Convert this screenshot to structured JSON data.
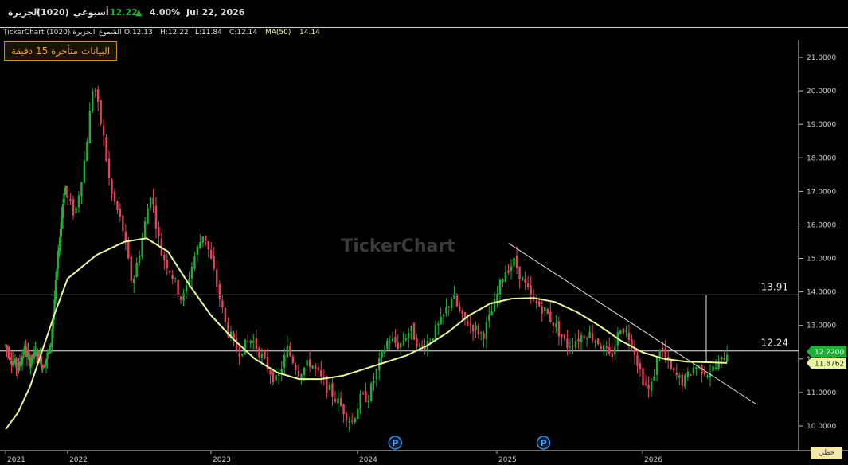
{
  "header": {
    "symbol_name": "الجزيرة",
    "symbol_code": "(1020)",
    "period": "أسبوعي",
    "price": "12.22",
    "change_pct": "4.00%",
    "date": "Jul 22, 2026"
  },
  "info": {
    "source": "TickerChart (1020) الجزيرة",
    "type": "الشموع",
    "open": "O:12.13",
    "high": "H:12.22",
    "low": "L:11.84",
    "close": "C:12.14",
    "ma_label": "MA(50)",
    "ma_value": "14.14"
  },
  "delay_notice": "البيانات متأخرة 15 دقيقة",
  "watermark": "TickerChart",
  "scale_button": "خطي",
  "colors": {
    "up": "#1fae3a",
    "down": "#e0455a",
    "ma": "#e6f7a0",
    "trend": "#dddddd",
    "background": "#000000",
    "price_tag": "#1fae3a",
    "ma_tag": "#e6f7a0"
  },
  "chart_data": {
    "type": "candlestick",
    "x_ticks": [
      "2021",
      "2022",
      "2023",
      "2024",
      "2025",
      "2026"
    ],
    "y_ticks": [
      "10.0000",
      "11.0000",
      "12.0000",
      "13.0000",
      "14.0000",
      "15.0000",
      "16.0000",
      "17.0000",
      "18.0000",
      "19.0000",
      "20.0000",
      "21.0000"
    ],
    "ylim": [
      9.6,
      21.4
    ],
    "xlim": [
      2021.0,
      2026.95
    ],
    "horizontal_lines": [
      {
        "label": "13.91",
        "value": 13.91
      },
      {
        "label": "12.24",
        "value": 12.24
      }
    ],
    "last_price_tag": "12.2200",
    "ma_tag": "11.8762",
    "trend_line": {
      "start": [
        2025.08,
        15.45
      ],
      "end": [
        2026.78,
        10.65
      ]
    },
    "event_markers": [
      "P",
      "P"
    ],
    "event_marker_x": [
      2024.27,
      2025.32
    ],
    "price_path": [
      [
        2021.0,
        12.4
      ],
      [
        2021.1,
        12.0
      ],
      [
        2021.2,
        11.7
      ],
      [
        2021.3,
        12.3
      ],
      [
        2021.4,
        11.9
      ],
      [
        2021.5,
        12.2
      ],
      [
        2021.6,
        11.8
      ],
      [
        2021.72,
        12.3
      ],
      [
        2021.8,
        14.0
      ],
      [
        2021.88,
        15.8
      ],
      [
        2021.95,
        17.2
      ],
      [
        2022.05,
        16.3
      ],
      [
        2022.12,
        18.0
      ],
      [
        2022.18,
        20.3
      ],
      [
        2022.25,
        18.6
      ],
      [
        2022.3,
        17.0
      ],
      [
        2022.38,
        16.0
      ],
      [
        2022.45,
        14.2
      ],
      [
        2022.52,
        15.6
      ],
      [
        2022.58,
        17.0
      ],
      [
        2022.65,
        15.2
      ],
      [
        2022.72,
        14.6
      ],
      [
        2022.8,
        13.7
      ],
      [
        2022.88,
        15.0
      ],
      [
        2022.95,
        15.8
      ],
      [
        2023.02,
        14.6
      ],
      [
        2023.1,
        13.0
      ],
      [
        2023.18,
        12.2
      ],
      [
        2023.28,
        12.6
      ],
      [
        2023.38,
        11.8
      ],
      [
        2023.45,
        11.3
      ],
      [
        2023.52,
        12.3
      ],
      [
        2023.6,
        11.6
      ],
      [
        2023.68,
        11.9
      ],
      [
        2023.75,
        11.4
      ],
      [
        2023.82,
        11.0
      ],
      [
        2023.9,
        10.5
      ],
      [
        2023.96,
        10.1
      ],
      [
        2024.02,
        10.8
      ],
      [
        2024.08,
        10.9
      ],
      [
        2024.15,
        11.8
      ],
      [
        2024.22,
        12.6
      ],
      [
        2024.3,
        12.4
      ],
      [
        2024.38,
        12.9
      ],
      [
        2024.45,
        12.3
      ],
      [
        2024.52,
        12.6
      ],
      [
        2024.6,
        13.1
      ],
      [
        2024.68,
        13.9
      ],
      [
        2024.75,
        13.2
      ],
      [
        2024.82,
        13.0
      ],
      [
        2024.9,
        12.7
      ],
      [
        2024.98,
        13.6
      ],
      [
        2025.05,
        14.6
      ],
      [
        2025.12,
        14.9
      ],
      [
        2025.18,
        14.3
      ],
      [
        2025.25,
        13.7
      ],
      [
        2025.32,
        13.5
      ],
      [
        2025.4,
        13.0
      ],
      [
        2025.48,
        12.4
      ],
      [
        2025.55,
        12.6
      ],
      [
        2025.62,
        12.8
      ],
      [
        2025.7,
        12.5
      ],
      [
        2025.78,
        12.0
      ],
      [
        2025.85,
        13.0
      ],
      [
        2025.92,
        12.6
      ],
      [
        2026.0,
        11.4
      ],
      [
        2026.05,
        11.0
      ],
      [
        2026.12,
        12.4
      ],
      [
        2026.2,
        11.6
      ],
      [
        2026.28,
        11.3
      ],
      [
        2026.36,
        11.8
      ],
      [
        2026.45,
        11.6
      ],
      [
        2026.52,
        11.8
      ],
      [
        2026.58,
        12.22
      ]
    ],
    "ma50_path": [
      [
        2021.0,
        9.9
      ],
      [
        2021.2,
        10.4
      ],
      [
        2021.4,
        11.2
      ],
      [
        2021.6,
        12.3
      ],
      [
        2021.8,
        13.4
      ],
      [
        2022.0,
        14.4
      ],
      [
        2022.2,
        15.1
      ],
      [
        2022.4,
        15.5
      ],
      [
        2022.55,
        15.6
      ],
      [
        2022.7,
        15.2
      ],
      [
        2022.85,
        14.2
      ],
      [
        2023.0,
        13.3
      ],
      [
        2023.15,
        12.6
      ],
      [
        2023.3,
        12.0
      ],
      [
        2023.45,
        11.6
      ],
      [
        2023.6,
        11.4
      ],
      [
        2023.75,
        11.4
      ],
      [
        2023.9,
        11.5
      ],
      [
        2024.05,
        11.7
      ],
      [
        2024.2,
        11.9
      ],
      [
        2024.35,
        12.1
      ],
      [
        2024.5,
        12.4
      ],
      [
        2024.65,
        12.8
      ],
      [
        2024.8,
        13.3
      ],
      [
        2024.95,
        13.65
      ],
      [
        2025.1,
        13.8
      ],
      [
        2025.25,
        13.82
      ],
      [
        2025.4,
        13.7
      ],
      [
        2025.55,
        13.4
      ],
      [
        2025.7,
        13.0
      ],
      [
        2025.85,
        12.55
      ],
      [
        2026.0,
        12.2
      ],
      [
        2026.15,
        12.0
      ],
      [
        2026.3,
        11.92
      ],
      [
        2026.45,
        11.9
      ],
      [
        2026.58,
        11.88
      ]
    ]
  }
}
